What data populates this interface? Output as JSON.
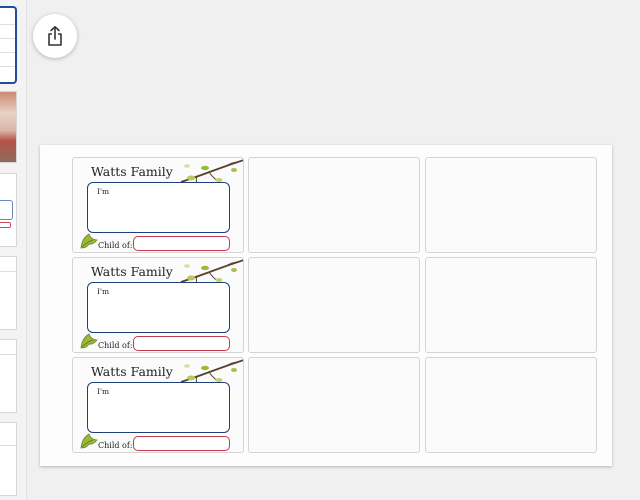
{
  "labels": {
    "family_title": "Watts Family",
    "name_prefix": "I'm",
    "child_of": "Child of:"
  },
  "icons": {
    "share": "share-icon",
    "leaf": "leaf-icon",
    "branch": "branch-decoration-icon"
  },
  "colors": {
    "name_box_border": "#1e3f78",
    "parent_box_border": "#c23a4f",
    "leaf_green": "#9bb83a",
    "thumbnail_selected_border": "#1f4f9a"
  }
}
